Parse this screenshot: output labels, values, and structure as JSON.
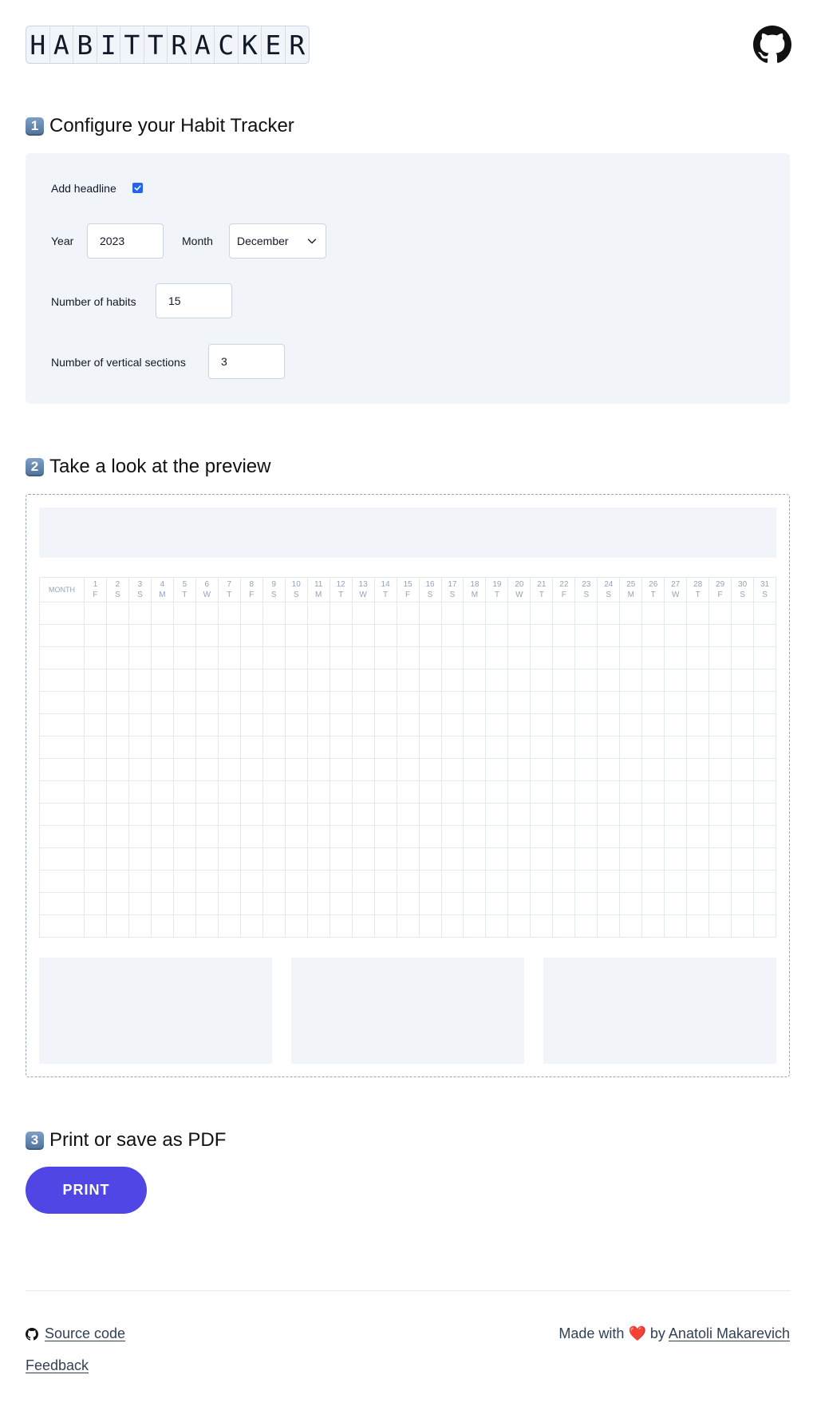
{
  "logo": {
    "letters": [
      "H",
      "A",
      "B",
      "I",
      "T",
      "T",
      "R",
      "A",
      "C",
      "K",
      "E",
      "R"
    ]
  },
  "header": {
    "github_icon": "github-icon"
  },
  "steps": {
    "configure": {
      "number": "1",
      "title": "Configure your Habit Tracker"
    },
    "preview": {
      "number": "2",
      "title": "Take a look at the preview"
    },
    "print": {
      "number": "3",
      "title": "Print or save as PDF"
    }
  },
  "config": {
    "add_headline_label": "Add headline",
    "add_headline_checked": true,
    "year_label": "Year",
    "year_value": "2023",
    "month_label": "Month",
    "month_value": "December",
    "habits_label": "Number of habits",
    "habits_value": "15",
    "sections_label": "Number of vertical sections",
    "sections_value": "3"
  },
  "preview": {
    "month_header": "MONTH",
    "days": [
      {
        "n": "1",
        "d": "F"
      },
      {
        "n": "2",
        "d": "S"
      },
      {
        "n": "3",
        "d": "S"
      },
      {
        "n": "4",
        "d": "M"
      },
      {
        "n": "5",
        "d": "T"
      },
      {
        "n": "6",
        "d": "W"
      },
      {
        "n": "7",
        "d": "T"
      },
      {
        "n": "8",
        "d": "F"
      },
      {
        "n": "9",
        "d": "S"
      },
      {
        "n": "10",
        "d": "S"
      },
      {
        "n": "11",
        "d": "M"
      },
      {
        "n": "12",
        "d": "T"
      },
      {
        "n": "13",
        "d": "W"
      },
      {
        "n": "14",
        "d": "T"
      },
      {
        "n": "15",
        "d": "F"
      },
      {
        "n": "16",
        "d": "S"
      },
      {
        "n": "17",
        "d": "S"
      },
      {
        "n": "18",
        "d": "M"
      },
      {
        "n": "19",
        "d": "T"
      },
      {
        "n": "20",
        "d": "W"
      },
      {
        "n": "21",
        "d": "T"
      },
      {
        "n": "22",
        "d": "F"
      },
      {
        "n": "23",
        "d": "S"
      },
      {
        "n": "24",
        "d": "S"
      },
      {
        "n": "25",
        "d": "M"
      },
      {
        "n": "26",
        "d": "T"
      },
      {
        "n": "27",
        "d": "W"
      },
      {
        "n": "28",
        "d": "T"
      },
      {
        "n": "29",
        "d": "F"
      },
      {
        "n": "30",
        "d": "S"
      },
      {
        "n": "31",
        "d": "S"
      }
    ],
    "habit_rows": 15,
    "vertical_sections": 3
  },
  "print": {
    "button_label": "PRINT"
  },
  "footer": {
    "source_code_label": "Source code",
    "feedback_label": "Feedback",
    "made_with_prefix": "Made with",
    "heart_glyph": "❤️",
    "made_with_by": "by",
    "author_label": "Anatoli Makarevich"
  },
  "colors": {
    "accent": "#4f46e5",
    "panel_bg": "#f1f5f9",
    "grid_line": "#e2e8f0",
    "checkbox": "#2563eb",
    "heart": "#e11d48"
  }
}
